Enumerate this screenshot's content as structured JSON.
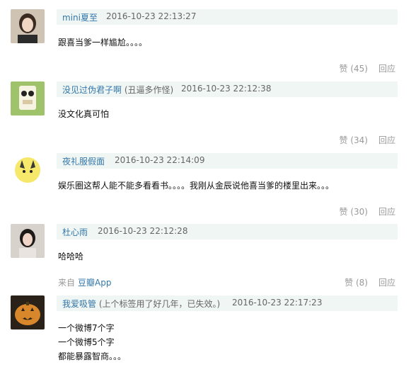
{
  "comments": [
    {
      "user": "mini夏至",
      "time": "2016-10-23 22:13:27",
      "lines": [
        "跟喜当爹一样尴尬。。。。"
      ],
      "like": "赞 (45)",
      "reply": "回应",
      "avatar": "photo-avatar"
    },
    {
      "user": "没见过伪君子啊",
      "note": "(丑逼多作怪)",
      "time": "2016-10-23 22:12:38",
      "lines": [
        "没文化真可怕"
      ],
      "like": "赞 (34)",
      "reply": "回应",
      "avatar": "cartoon-owl-avatar"
    },
    {
      "user": "夜礼服假面",
      "time": "2016-10-23 22:14:09",
      "lines": [
        "娱乐圈这帮人能不能多看看书。。。。我刚从金辰说他喜当爹的楼里出来。。。"
      ],
      "like": "赞 (30)",
      "reply": "回应",
      "avatar": "pikachu-avatar"
    },
    {
      "user": "杜心雨",
      "time": "2016-10-23 22:12:28",
      "lines": [
        "哈哈哈"
      ],
      "source_prefix": "来自",
      "source_app": "豆瓣App",
      "like": "赞 (8)",
      "reply": "回应",
      "avatar": "photo-avatar"
    },
    {
      "user": "我爱吸管",
      "note": "(上个标签用了好几年，已失效。)",
      "time": "2016-10-23 22:17:23",
      "lines": [
        "一个微博7个字",
        "一个微博5个字",
        "都能暴露智商。。。"
      ],
      "avatar": "pumpkin-avatar"
    }
  ],
  "colors": {
    "header_bg": "#f0f6f3",
    "username": "#3377aa",
    "meta": "#999999"
  }
}
